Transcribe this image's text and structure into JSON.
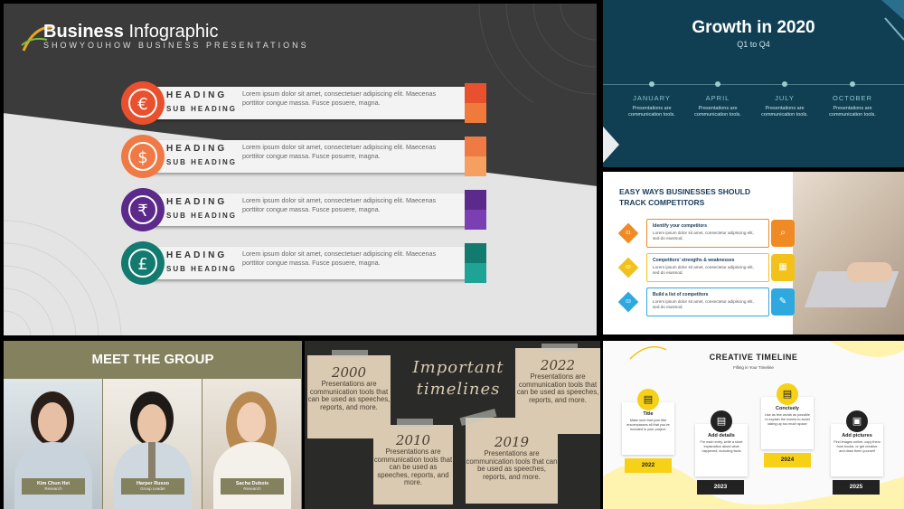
{
  "panel1": {
    "title_bold": "Business",
    "title_rest": " Infographic",
    "subtitle": "SHOWYOUHOW BUSINESS PRESENTATIONS",
    "rows": [
      {
        "icon": "€",
        "heading": "HEADING",
        "sub": "SUB HEADING",
        "text": "Lorem ipsum dolor sit amet, consectetuer adipiscing elit. Maecenas porttitor congue massa. Fusce posuere, magna.",
        "color": "#e8502e",
        "color2": "#f07a3c"
      },
      {
        "icon": "$",
        "heading": "HEADING",
        "sub": "SUB HEADING",
        "text": "Lorem ipsum dolor sit amet, consectetuer adipiscing elit. Maecenas porttitor congue massa. Fusce posuere, magna.",
        "color": "#ef7a45",
        "color2": "#f5a060"
      },
      {
        "icon": "₹",
        "heading": "HEADING",
        "sub": "SUB HEADING",
        "text": "Lorem ipsum dolor sit amet, consectetuer adipiscing elit. Maecenas porttitor congue massa. Fusce posuere, magna.",
        "color": "#5b2a8a",
        "color2": "#7a3fb0"
      },
      {
        "icon": "£",
        "heading": "HEADING",
        "sub": "SUB HEADING",
        "text": "Lorem ipsum dolor sit amet, consectetuer adipiscing elit. Maecenas porttitor congue massa. Fusce posuere, magna.",
        "color": "#137a70",
        "color2": "#1ea394"
      }
    ]
  },
  "panel2": {
    "title": "Growth in 2020",
    "subtitle": "Q1 to Q4",
    "months": [
      {
        "name": "JANUARY",
        "desc": "Presentations are communication tools."
      },
      {
        "name": "APRIL",
        "desc": "Presentations are communication tools."
      },
      {
        "name": "JULY",
        "desc": "Presentations are communication tools."
      },
      {
        "name": "OCTOBER",
        "desc": "Presentations are communication tools."
      }
    ]
  },
  "panel3": {
    "title": "EASY WAYS BUSINESSES SHOULD TRACK COMPETITORS",
    "steps": [
      {
        "num": "01",
        "heading": "Identify your competitors",
        "text": "Lorem ipsum dolor sit amet, consectetur adipiscing elit, sed do eiusmod.",
        "color": "#f08a24",
        "icon": "⌕"
      },
      {
        "num": "02",
        "heading": "Competitors' strengths & weaknesses",
        "text": "Lorem ipsum dolor sit amet, consectetur adipiscing elit, sed do eiusmod.",
        "color": "#f2c21b",
        "icon": "▦"
      },
      {
        "num": "03",
        "heading": "Build a list of competitors",
        "text": "Lorem ipsum dolor sit amet, consectetur adipiscing elit, sed do eiusmod.",
        "color": "#2ea9df",
        "icon": "✎"
      }
    ]
  },
  "panel4": {
    "title": "MEET THE GROUP",
    "people": [
      {
        "name": "Kim Chun Hei",
        "role": "Research"
      },
      {
        "name": "Harper Russo",
        "role": "Group Leader"
      },
      {
        "name": "Sacha Dubois",
        "role": "Research"
      }
    ]
  },
  "panel5": {
    "title": "Important timelines",
    "items": [
      {
        "year": "2000",
        "text": "Presentations are communication tools that can be used as speeches, reports, and more."
      },
      {
        "year": "2022",
        "text": "Presentations are communication tools that can be used as speeches, reports, and more."
      },
      {
        "year": "2010",
        "text": "Presentations are communication tools that can be used as speeches, reports, and more."
      },
      {
        "year": "2019",
        "text": "Presentations are communication tools that can be used as speeches, reports, and more."
      }
    ]
  },
  "panel6": {
    "title": "CREATIVE TIMELINE",
    "subtitle": "Filling in Your Timeline",
    "items": [
      {
        "title": "Title",
        "text": "Make sure that your title encompasses all that you've included in your project.",
        "year": "2022",
        "icon": "▤",
        "year_style": "yellow"
      },
      {
        "title": "Add details",
        "text": "For each entry, write a short explanation about what happened, including facts",
        "year": "2023",
        "icon": "▤",
        "year_style": "dark"
      },
      {
        "title": "Concisely",
        "text": "Use as few words as possible to explain the events to avoid taking up too much space",
        "year": "2024",
        "icon": "▤",
        "year_style": "yellow"
      },
      {
        "title": "Add pictures",
        "text": "Find images online, copy them from books, or get creative and draw them yourself",
        "year": "2025",
        "icon": "▣",
        "year_style": "dark"
      }
    ]
  }
}
